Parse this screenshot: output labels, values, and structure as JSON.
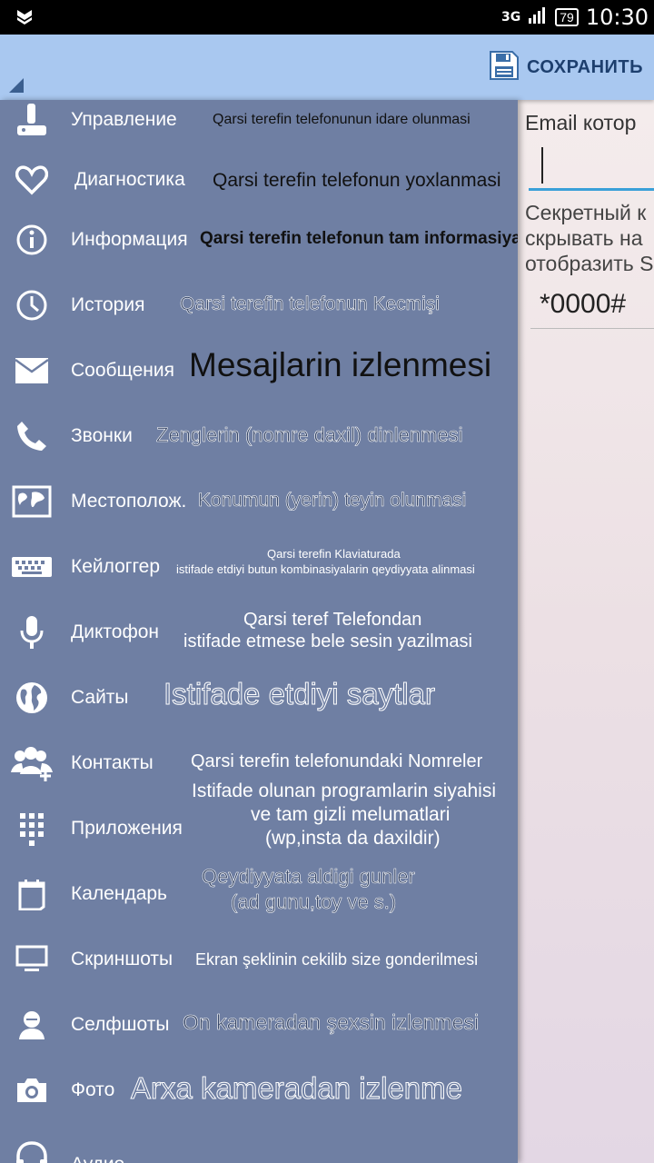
{
  "status_bar": {
    "network": "3G",
    "battery": "79",
    "time": "10:30"
  },
  "action_bar": {
    "save_label": "СОХРАНИТЬ"
  },
  "content": {
    "email_label": "Email котор",
    "secret_text": "Секретный к\nскрывать на\nотобразить S",
    "secret_code": "*0000#"
  },
  "drawer": {
    "items": [
      {
        "label": "Управление",
        "icon": "joystick-icon",
        "desc": "Qarsi terefin telefonunun idare olunmasi"
      },
      {
        "label": "Диагностика",
        "icon": "heart-icon",
        "desc": "Qarsi terefin telefonun yoxlanmasi"
      },
      {
        "label": "Информация",
        "icon": "info-icon",
        "desc": "Qarsi terefin telefonun tam informasiyasi"
      },
      {
        "label": "История",
        "icon": "clock-icon",
        "desc": "Qarsi terefin telefonun Kecmişi"
      },
      {
        "label": "Сообщения",
        "icon": "envelope-icon",
        "desc": "Mesajlarin izlenmesi"
      },
      {
        "label": "Звонки",
        "icon": "phone-icon",
        "desc": "Zenglerin (nomre daxil) dinlenmesi"
      },
      {
        "label": "Местополож.",
        "icon": "map-icon",
        "desc": "Konumun (yerin) teyin olunmasi"
      },
      {
        "label": "Кейлоггер",
        "icon": "keyboard-icon",
        "desc_line1": "Qarsi terefin Klaviaturada",
        "desc_line2": "istifade etdiyi butun kombinasiyalarin qeydiyyata alinmasi"
      },
      {
        "label": "Диктофон",
        "icon": "microphone-icon",
        "desc_line1": "Qarsi teref Telefondan",
        "desc_line2": "istifade etmese bele sesin yazilmasi"
      },
      {
        "label": "Сайты",
        "icon": "globe-icon",
        "desc": "Istifade etdiyi saytlar"
      },
      {
        "label": "Контакты",
        "icon": "contacts-icon",
        "desc": "Qarsi terefin telefonundaki Nomreler"
      },
      {
        "label": "Приложения",
        "icon": "apps-grid-icon",
        "desc_line1": "Istifade olunan programlarin siyahisi",
        "desc_line2": "ve tam gizli melumatlari",
        "desc_line3": "(wp,insta da daxildir)"
      },
      {
        "label": "Календарь",
        "icon": "calendar-icon",
        "desc_line1": "Qeydiyyata aldigi gunler",
        "desc_line2": "(ad gunu,toy ve s.)"
      },
      {
        "label": "Скриншоты",
        "icon": "monitor-icon",
        "desc": "Ekran şeklinin cekilib size gonderilmesi"
      },
      {
        "label": "Селфшоты",
        "icon": "person-icon",
        "desc": "On kameradan şexsin izlenmesi"
      },
      {
        "label": "Фото",
        "icon": "camera-icon",
        "desc": "Arxa kameradan izlenme"
      },
      {
        "label": "Аудио",
        "icon": "headphones-icon"
      }
    ]
  }
}
